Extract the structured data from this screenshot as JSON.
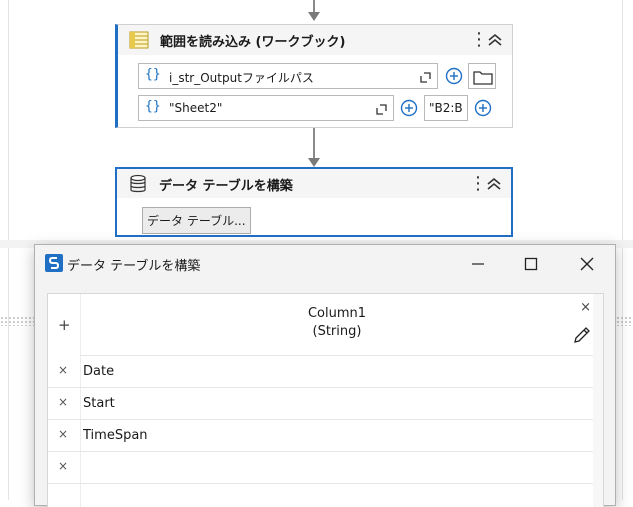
{
  "activity_read_range": {
    "title": "範囲を読み込み (ワークブック)",
    "workbook_path": "i_str_Outputファイルパス",
    "sheet_name": "\"Sheet2\"",
    "range": "\"B2:B"
  },
  "activity_build_table": {
    "title": "データ テーブルを構築",
    "button_label": "データ テーブル..."
  },
  "dialog": {
    "title": "データ テーブルを構築",
    "add_column": "+",
    "column": {
      "name": "Column1",
      "type": "(String)",
      "remove": "×"
    },
    "rows": [
      {
        "remove": "×",
        "value": "Date"
      },
      {
        "remove": "×",
        "value": "Start"
      },
      {
        "remove": "×",
        "value": "TimeSpan"
      },
      {
        "remove": "×",
        "value": ""
      }
    ]
  },
  "icons": {
    "kebab": "⋮",
    "brace": "{}",
    "accent": "#1f6fc5"
  }
}
